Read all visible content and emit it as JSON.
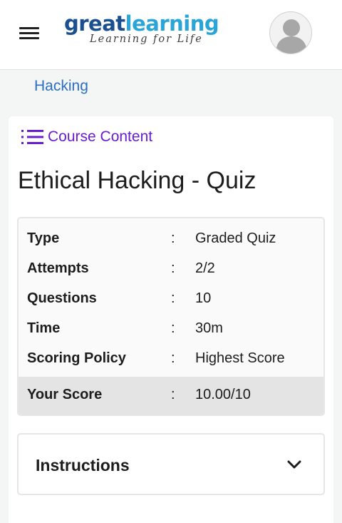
{
  "header": {
    "logo": {
      "great": "great",
      "learning": "learning",
      "tagline": "Learning for Life"
    }
  },
  "breadcrumb": {
    "label": "Hacking"
  },
  "course_content": {
    "label": "Course Content"
  },
  "quiz": {
    "title": "Ethical Hacking - Quiz",
    "rows": [
      {
        "key": "Type",
        "sep": ":",
        "value": "Graded Quiz"
      },
      {
        "key": "Attempts",
        "sep": ":",
        "value": "2/2"
      },
      {
        "key": "Questions",
        "sep": ":",
        "value": "10"
      },
      {
        "key": "Time",
        "sep": ":",
        "value": "30m"
      },
      {
        "key": "Scoring Policy",
        "sep": ":",
        "value": "Highest Score"
      }
    ],
    "score": {
      "key": "Your Score",
      "sep": ":",
      "value": "10.00/10"
    }
  },
  "instructions": {
    "label": "Instructions"
  },
  "colors": {
    "accent": "#6a1ccf",
    "link": "#2b6fc4",
    "brand_dark": "#1b4f8f",
    "brand_light": "#2ba5d8"
  },
  "icons": {
    "menu": "hamburger-menu-icon",
    "profile": "user-avatar-icon",
    "content": "list-icon",
    "expand": "chevron-down-icon"
  }
}
